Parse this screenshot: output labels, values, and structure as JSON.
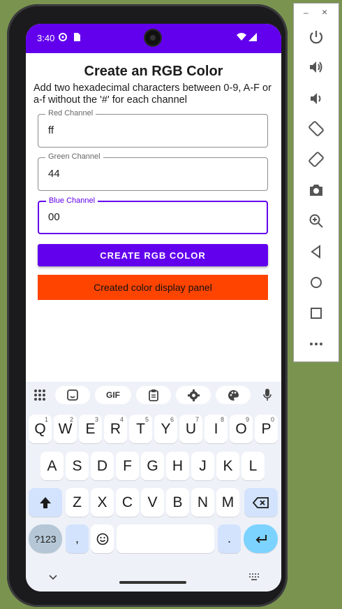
{
  "status_bar": {
    "time": "3:40"
  },
  "app": {
    "title": "Create an RGB Color",
    "description": "Add two hexadecimal characters between 0-9, A-F or a-f without the '#' for each channel",
    "fields": [
      {
        "label": "Red Channel",
        "value": "ff"
      },
      {
        "label": "Green Channel",
        "value": "44"
      },
      {
        "label": "Blue Channel",
        "value": "00"
      }
    ],
    "button_label": "CREATE RGB COLOR",
    "panel_label": "Created color display panel",
    "panel_color": "#ff4400",
    "accent_color": "#6200ee"
  },
  "keyboard": {
    "toolbar": {
      "gif": "GIF"
    },
    "row1": [
      {
        "k": "Q",
        "n": "1"
      },
      {
        "k": "W",
        "n": "2"
      },
      {
        "k": "E",
        "n": "3"
      },
      {
        "k": "R",
        "n": "4"
      },
      {
        "k": "T",
        "n": "5"
      },
      {
        "k": "Y",
        "n": "6"
      },
      {
        "k": "U",
        "n": "7"
      },
      {
        "k": "I",
        "n": "8"
      },
      {
        "k": "O",
        "n": "9"
      },
      {
        "k": "P",
        "n": "0"
      }
    ],
    "row2": [
      "A",
      "S",
      "D",
      "F",
      "G",
      "H",
      "J",
      "K",
      "L"
    ],
    "row3": [
      "Z",
      "X",
      "C",
      "V",
      "B",
      "N",
      "M"
    ],
    "sym_label": "?123",
    "comma": ",",
    "period": "."
  },
  "side_panel": {
    "minimize": "–",
    "close": "×",
    "icons": [
      "power-icon",
      "volume-up-icon",
      "volume-down-icon",
      "rotate-left-icon",
      "rotate-right-icon",
      "camera-icon",
      "zoom-icon",
      "back-icon",
      "home-icon",
      "overview-icon",
      "more-icon"
    ]
  }
}
